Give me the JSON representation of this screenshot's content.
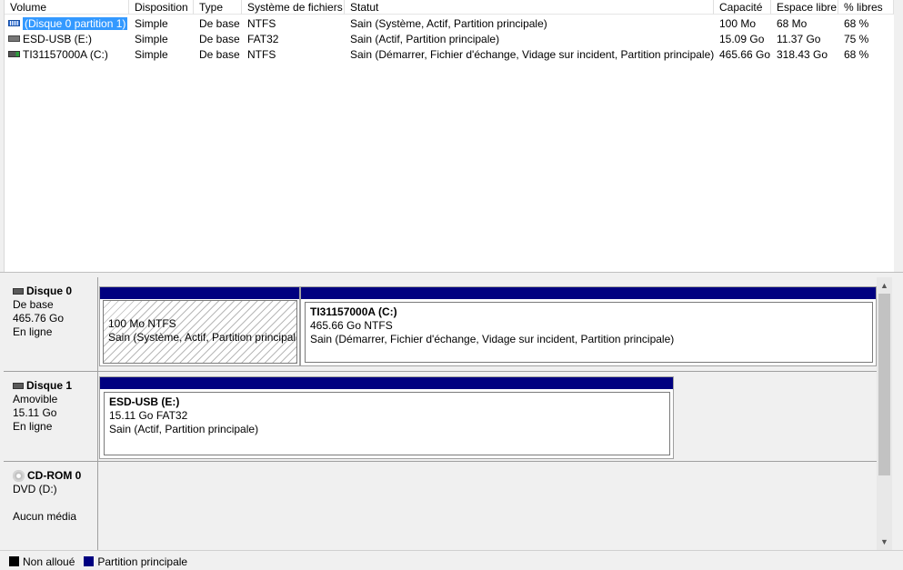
{
  "columns": [
    "Volume",
    "Disposition",
    "Type",
    "Système de fichiers",
    "Statut",
    "Capacité",
    "Espace libre",
    "% libres"
  ],
  "volumes": [
    {
      "name": "(Disque 0 partition 1)",
      "disposition": "Simple",
      "type": "De base",
      "fs": "NTFS",
      "status": "Sain (Système, Actif, Partition principale)",
      "capacity": "100 Mo",
      "free": "68 Mo",
      "pct": "68 %",
      "icon": "volume-drive-blue-icon",
      "selected": true
    },
    {
      "name": "ESD-USB (E:)",
      "disposition": "Simple",
      "type": "De base",
      "fs": "FAT32",
      "status": "Sain (Actif, Partition principale)",
      "capacity": "15.09 Go",
      "free": "11.37 Go",
      "pct": "75 %",
      "icon": "volume-drive-gray-icon"
    },
    {
      "name": "TI31157000A (C:)",
      "disposition": "Simple",
      "type": "De base",
      "fs": "NTFS",
      "status": "Sain (Démarrer, Fichier d'échange, Vidage sur incident, Partition principale)",
      "capacity": "465.66 Go",
      "free": "318.43 Go",
      "pct": "68 %",
      "icon": "volume-drive-green-icon"
    }
  ],
  "disks": [
    {
      "name": "Disque 0",
      "kind": "De base",
      "size": "465.76 Go",
      "state": "En ligne",
      "partitions": [
        {
          "title": "",
          "size": "100 Mo NTFS",
          "status": "Sain (Système, Actif, Partition principale)"
        },
        {
          "title": "TI31157000A  (C:)",
          "size": "465.66 Go NTFS",
          "status": "Sain (Démarrer, Fichier d'échange, Vidage sur incident, Partition principale)"
        }
      ]
    },
    {
      "name": "Disque 1",
      "kind": "Amovible",
      "size": "15.11 Go",
      "state": "En ligne",
      "partitions": [
        {
          "title": "ESD-USB  (E:)",
          "size": "15.11 Go FAT32",
          "status": "Sain (Actif, Partition principale)"
        }
      ]
    },
    {
      "name": "CD-ROM 0",
      "kind": "DVD (D:)",
      "size": "",
      "state": "Aucun média"
    }
  ],
  "legend": [
    {
      "label": "Non alloué",
      "color": "#000000"
    },
    {
      "label": "Partition principale",
      "color": "#000080"
    }
  ]
}
